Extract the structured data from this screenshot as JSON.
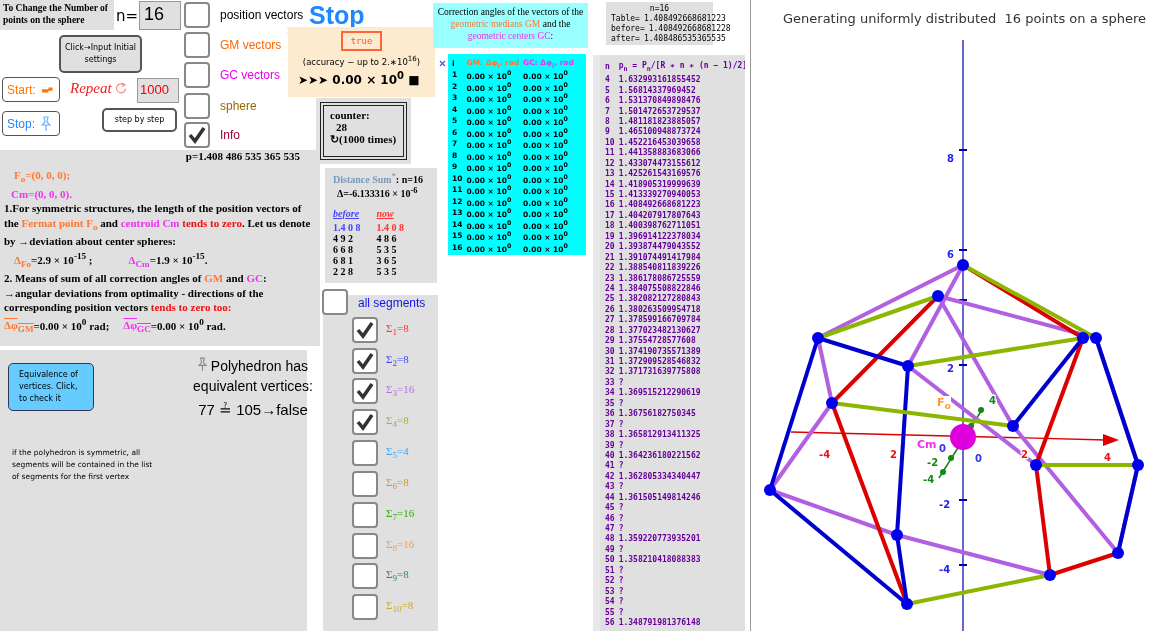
{
  "settings_label": "To Change the Number of points on the sphere",
  "n_field": {
    "label": "n=",
    "value": "16"
  },
  "input_button": "Click→Input Initial settings",
  "start_button": "Start:",
  "repeat": {
    "label": "Repeat",
    "value": "1000"
  },
  "stop_button": "Stop:",
  "step_button": "step by step",
  "toggles": [
    {
      "label": "position vectors",
      "checked": false,
      "color": "#000000"
    },
    {
      "label": "GM vectors",
      "checked": false,
      "color": "#ff6600"
    },
    {
      "label": "GC vectors",
      "checked": false,
      "color": "#ee00ee"
    },
    {
      "label": "sphere",
      "checked": false,
      "color": "#996600"
    },
    {
      "label": "Info",
      "checked": true,
      "color": "#990033"
    }
  ],
  "stop_text": "Stop",
  "accuracy": {
    "button": "true",
    "note": "(accuracy − up to 2.∗10$^{16}$)",
    "value": "➤➤➤ 0.00 × 10$^{0}$ ■"
  },
  "counter": {
    "label": "counter:",
    "count": "28",
    "times": "↻(1000 times)"
  },
  "p_value": "p=1.408 486 535 365 535",
  "info": {
    "fermat": "F$_{o}$=(0, 0, 0);",
    "centroid": "Cm=(0, 0, 0).",
    "paragraph_1": [
      {
        "kind": "plain",
        "text": "1.For symmetric structures, the length of the position vectors of the "
      },
      {
        "kind": "fermat",
        "text": "Fermat point  F$_{o}$"
      },
      {
        "kind": "plain",
        "text": " and  "
      },
      {
        "kind": "centroid",
        "text": "centroid Cm"
      },
      {
        "kind": "emphasis",
        "text": " tends to zero"
      },
      {
        "kind": "plain",
        "text": ". Let us denote by →deviation about center spheres:"
      }
    ],
    "deviations": [
      {
        "kind": "fermat",
        "symbol": "Δ$_{Fo}$",
        "value": "=2.9 × 10$^{-15}$ ;"
      },
      {
        "kind": "centroid",
        "symbol": "Δ$_{Cm}$",
        "value": "=1.9 × 10$^{-15}$."
      }
    ],
    "paragraph_2": [
      {
        "kind": "plain",
        "text": "2. Means of sum of all correction angles of "
      },
      {
        "kind": "fermat",
        "text": "GM"
      },
      {
        "kind": "plain",
        "text": " and "
      },
      {
        "kind": "centroid",
        "text": "GC"
      },
      {
        "kind": "plain",
        "text": ": →angular deviations from optimality - directions of the corresponding position vectors "
      },
      {
        "kind": "emphasis",
        "text": "tends to zero too:"
      }
    ],
    "angles": [
      {
        "kind": "fermat",
        "symbol": "Δφ$_{GM}$",
        "value": "=0.00 × 10$^{0}$  rad;"
      },
      {
        "kind": "centroid",
        "symbol": "Δφ$_{GC}$",
        "value": "=0.00 × 10$^{0}$  rad."
      }
    ]
  },
  "equivalence_button": "Equivalence of vertices. Click, to check it",
  "polyhedron_status": {
    "text": "Polyhedron has equivalent vertices:",
    "result": "77 ≟ 105→false"
  },
  "symmetry_note": "if the polyhedron is symmetric, all segments will be contained in the list of segments for the first vertex",
  "distance_sum": {
    "title": "Distance Sum$^{*}$",
    "n": ": n=16",
    "delta": "Δ=-6.133316 × 10$^{-6}$",
    "columns": [
      {
        "header": "before",
        "digits": [
          "1.4 0 8",
          "4 9 2",
          "6 6 8",
          "6 8 1",
          "2 2 8"
        ]
      },
      {
        "header": "now",
        "digits": [
          "1.4 0 8",
          "4 8 6",
          "5 3 5",
          "3 6 5",
          "5 3 5"
        ]
      }
    ]
  },
  "correction_title": [
    {
      "kind": "plain",
      "text": "Correction angles of the vectors of the "
    },
    {
      "kind": "fermat",
      "text": "geometric medians GM"
    },
    {
      "kind": "plain",
      "text": " and the "
    },
    {
      "kind": "centroid",
      "text": "geometric centers  GC"
    },
    {
      "kind": "plain",
      "text": ":"
    }
  ],
  "correction_table": {
    "columns": [
      "i",
      "GM: Δφ$_{i}$, rad",
      "GC: Δφ$_{i}$, rad"
    ],
    "rows": [
      [
        "1",
        "0.00 × 10$^{0}$",
        "0.00 × 10$^{0}$"
      ],
      [
        "2",
        "0.00 × 10$^{0}$",
        "0.00 × 10$^{0}$"
      ],
      [
        "3",
        "0.00 × 10$^{0}$",
        "0.00 × 10$^{0}$"
      ],
      [
        "4",
        "0.00 × 10$^{0}$",
        "0.00 × 10$^{0}$"
      ],
      [
        "5",
        "0.00 × 10$^{0}$",
        "0.00 × 10$^{0}$"
      ],
      [
        "6",
        "0.00 × 10$^{0}$",
        "0.00 × 10$^{0}$"
      ],
      [
        "7",
        "0.00 × 10$^{0}$",
        "0.00 × 10$^{0}$"
      ],
      [
        "8",
        "0.00 × 10$^{0}$",
        "0.00 × 10$^{0}$"
      ],
      [
        "9",
        "0.00 × 10$^{0}$",
        "0.00 × 10$^{0}$"
      ],
      [
        "10",
        "0.00 × 10$^{0}$",
        "0.00 × 10$^{0}$"
      ],
      [
        "11",
        "0.00 × 10$^{0}$",
        "0.00 × 10$^{0}$"
      ],
      [
        "12",
        "0.00 × 10$^{0}$",
        "0.00 × 10$^{0}$"
      ],
      [
        "13",
        "0.00 × 10$^{0}$",
        "0.00 × 10$^{0}$"
      ],
      [
        "14",
        "0.00 × 10$^{0}$",
        "0.00 × 10$^{0}$"
      ],
      [
        "15",
        "0.00 × 10$^{0}$",
        "0.00 × 10$^{0}$"
      ],
      [
        "16",
        "0.00 × 10$^{0}$",
        "0.00 × 10$^{0}$"
      ]
    ]
  },
  "segments": {
    "all": {
      "label": "all segments",
      "checked": false
    },
    "items": [
      {
        "label": "Σ$_{1}$=8",
        "checked": true,
        "color": "#ff3333"
      },
      {
        "label": "Σ$_{2}$=8",
        "checked": true,
        "color": "#4444ff"
      },
      {
        "label": "Σ$_{3}$=16",
        "checked": true,
        "color": "#b070e0"
      },
      {
        "label": "Σ$_{4}$=8",
        "checked": true,
        "color": "#99bb22"
      },
      {
        "label": "Σ$_{5}$=4",
        "checked": false,
        "color": "#33aaff"
      },
      {
        "label": "Σ$_{6}$=8",
        "checked": false,
        "color": "#cc9933"
      },
      {
        "label": "Σ$_{7}$=16",
        "checked": false,
        "color": "#33aa11"
      },
      {
        "label": "Σ$_{8}$=16",
        "checked": false,
        "color": "#ff9944"
      },
      {
        "label": "Σ$_{9}$=8",
        "checked": false,
        "color": "#338866"
      },
      {
        "label": "Σ$_{10}$=8",
        "checked": false,
        "color": "#ccaa33"
      }
    ]
  },
  "summary": {
    "n": "n=16",
    "rows": [
      {
        "label": "Table=",
        "value": "1.408492668681223"
      },
      {
        "label": "before=",
        "value": "1.408492668681228"
      },
      {
        "label": "after=",
        "value": "1.408486535365535"
      }
    ]
  },
  "p_table": {
    "columns": [
      "n",
      "p$_{n}$ = P$_{n}$/[R ∗ n ∗ (n − 1)/2]"
    ],
    "rows": [
      [
        "4",
        "1.632993161855452"
      ],
      [
        "5",
        "1.56814337969452"
      ],
      [
        "6",
        "1.531370849898476"
      ],
      [
        "7",
        "1.501472653729537"
      ],
      [
        "8",
        "1.481181823885057"
      ],
      [
        "9",
        "1.465100948873724"
      ],
      [
        "10",
        "1.452216453039658"
      ],
      [
        "11",
        "1.441358883683066"
      ],
      [
        "12",
        "1.433074473155612"
      ],
      [
        "13",
        "1.425261543169576"
      ],
      [
        "14",
        "1.418905319999639"
      ],
      [
        "15",
        "1.413339270940053"
      ],
      [
        "16",
        "1.408492668681223"
      ],
      [
        "17",
        "1.404207917807643"
      ],
      [
        "18",
        "1.400398762711051"
      ],
      [
        "19",
        "1.396914122378034"
      ],
      [
        "20",
        "1.393874479043552"
      ],
      [
        "21",
        "1.391074491417984"
      ],
      [
        "22",
        "1.388540811839226"
      ],
      [
        "23",
        "1.386178086725559"
      ],
      [
        "24",
        "1.384075508822846"
      ],
      [
        "25",
        "1.382082127280843"
      ],
      [
        "26",
        "1.380263509954718"
      ],
      [
        "27",
        "1.378599166709784"
      ],
      [
        "28",
        "1.377023482130627"
      ],
      [
        "29",
        "1.37554728577608"
      ],
      [
        "30",
        "1.374190735571389"
      ],
      [
        "31",
        "1.372909528546832"
      ],
      [
        "32",
        "1.371731639775808"
      ],
      [
        "33",
        "?"
      ],
      [
        "34",
        "1.369515212290619"
      ],
      [
        "35",
        "?"
      ],
      [
        "36",
        "1.36756182750345"
      ],
      [
        "37",
        "?"
      ],
      [
        "38",
        "1.365812913411325"
      ],
      [
        "39",
        "?"
      ],
      [
        "40",
        "1.364236180221562"
      ],
      [
        "41",
        "?"
      ],
      [
        "42",
        "1.362805334340447"
      ],
      [
        "43",
        "?"
      ],
      [
        "44",
        "1.361505149814246"
      ],
      [
        "45",
        "?"
      ],
      [
        "46",
        "?"
      ],
      [
        "47",
        "?"
      ],
      [
        "48",
        "1.359220773935201"
      ],
      [
        "49",
        "?"
      ],
      [
        "50",
        "1.358210418088383"
      ],
      [
        "51",
        "?"
      ],
      [
        "52",
        "?"
      ],
      [
        "53",
        "?"
      ],
      [
        "54",
        "?"
      ],
      [
        "55",
        "?"
      ],
      [
        "56",
        "1.348791981376148"
      ]
    ]
  },
  "view3d": {
    "title": "Generating uniformly distributed  16 points on a sphere",
    "z_ticks": [
      "8",
      "6",
      "2",
      "-2",
      "-4"
    ],
    "x_ticks": [
      "-4",
      "2",
      "2",
      "4"
    ],
    "y_ticks": [
      "4",
      "-2",
      "-4"
    ],
    "origin_labels": [
      "0",
      "0"
    ],
    "point_labels": [
      {
        "kind": "fermat",
        "text": "F$_{o}$"
      },
      {
        "kind": "centroid",
        "text": "Cm"
      }
    ]
  }
}
